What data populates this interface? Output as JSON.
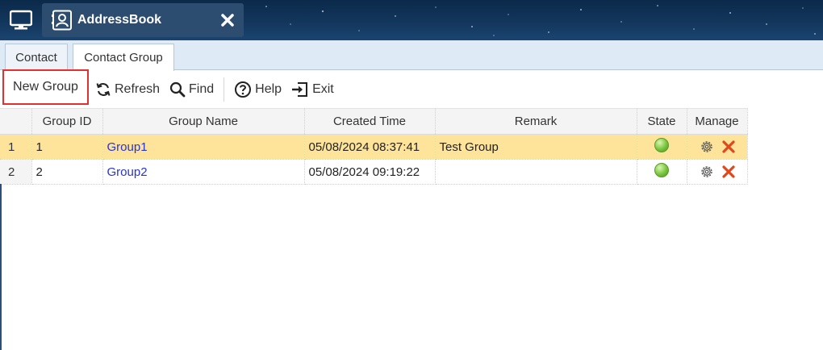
{
  "app": {
    "title": "AddressBook"
  },
  "tabs": [
    {
      "label": "Contact",
      "active": false
    },
    {
      "label": "Contact Group",
      "active": true
    }
  ],
  "toolbar": {
    "new_group": "New Group",
    "refresh": "Refresh",
    "find": "Find",
    "help": "Help",
    "exit": "Exit"
  },
  "grid": {
    "columns": [
      "",
      "Group ID",
      "Group Name",
      "Created Time",
      "Remark",
      "State",
      "Manage"
    ],
    "rows": [
      {
        "num": "1",
        "id": "1",
        "name": "Group1",
        "created": "05/08/2024 08:37:41",
        "remark": "Test Group",
        "state": "active",
        "selected": true
      },
      {
        "num": "2",
        "id": "2",
        "name": "Group2",
        "created": "05/08/2024 09:19:22",
        "remark": "",
        "state": "active",
        "selected": false
      }
    ]
  },
  "colors": {
    "selected_row": "#fde49a",
    "link": "#2a34c9",
    "highlight_border": "#e23030",
    "state_ok": "#79c43c"
  },
  "icons": {
    "desktop": "desktop-icon",
    "app": "contact-card-icon",
    "close": "close-icon",
    "refresh": "refresh-icon",
    "find": "search-icon",
    "help": "help-icon",
    "exit": "exit-icon",
    "settings": "gear-icon",
    "delete": "delete-icon"
  }
}
